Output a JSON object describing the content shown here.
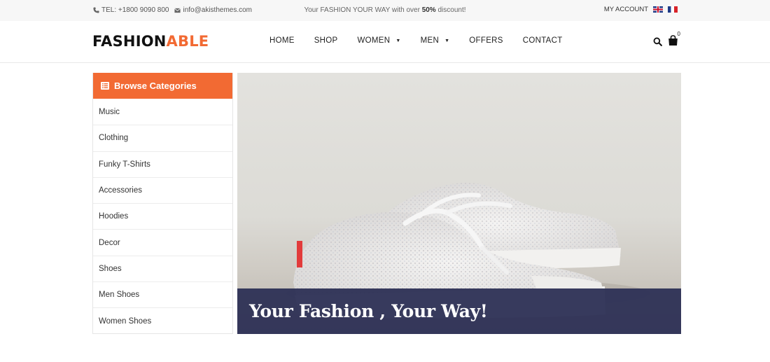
{
  "topbar": {
    "phone": "TEL: +1800 9090 800",
    "email": "info@akisthemes.com",
    "promo_prefix": "Your FASHION YOUR WAY with over ",
    "promo_bold": "50%",
    "promo_suffix": " discount!",
    "account_label": "MY ACCOUNT",
    "languages": [
      "english-flag-icon",
      "french-flag-icon"
    ]
  },
  "header": {
    "logo_part1": "FASHION",
    "logo_part2": "ABLE",
    "nav": {
      "home": "HOME",
      "shop": "SHOP",
      "women": "WOMEN",
      "men": "MEN",
      "offers": "OFFERS",
      "contact": "CONTACT"
    },
    "cart_count": "0"
  },
  "sidebar": {
    "title": "Browse Categories",
    "categories": [
      "Music",
      "Clothing",
      "Funky T-Shirts",
      "Accessories",
      "Hoodies",
      "Decor",
      "Shoes",
      "Men Shoes",
      "Women Shoes"
    ]
  },
  "banner": {
    "caption": "Your Fashion , Your Way!"
  },
  "colors": {
    "accent": "#f26a33",
    "caption_bg": "#2f3256"
  }
}
